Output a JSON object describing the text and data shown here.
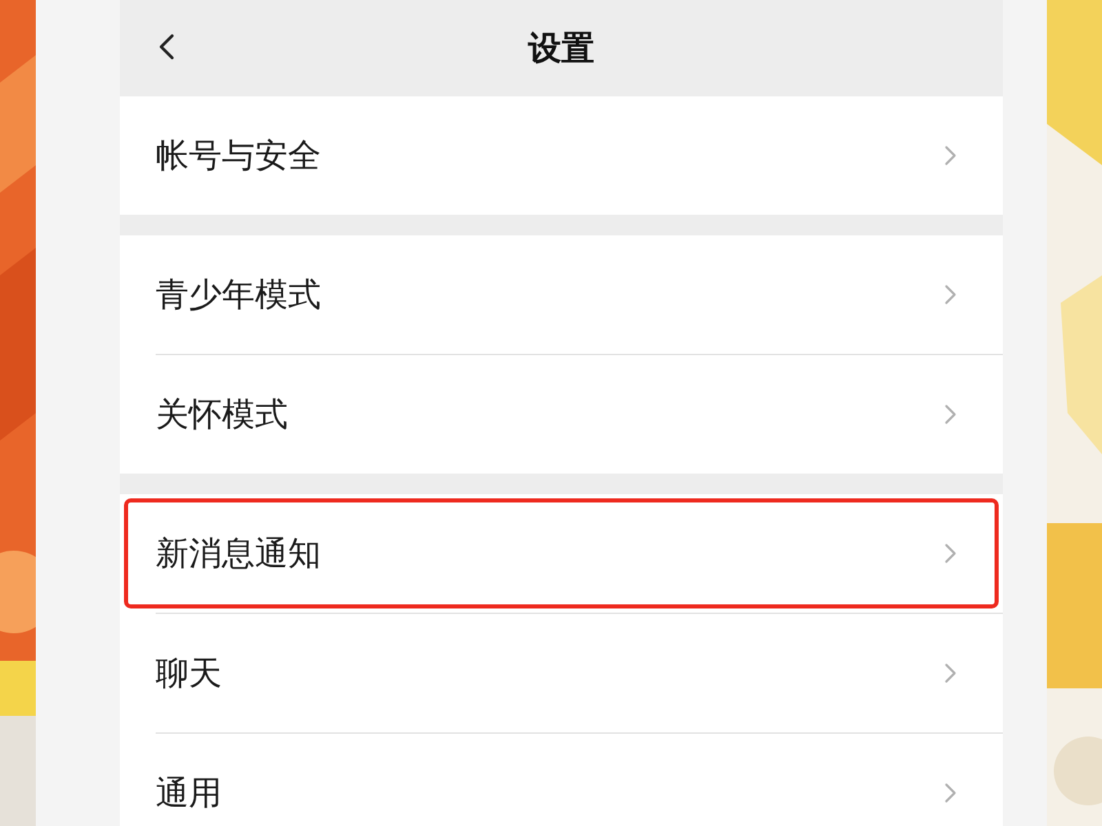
{
  "header": {
    "title": "设置"
  },
  "groups": [
    {
      "items": [
        {
          "label": "帐号与安全",
          "highlighted": false
        }
      ]
    },
    {
      "items": [
        {
          "label": "青少年模式",
          "highlighted": false
        },
        {
          "label": "关怀模式",
          "highlighted": false
        }
      ]
    },
    {
      "items": [
        {
          "label": "新消息通知",
          "highlighted": true
        },
        {
          "label": "聊天",
          "highlighted": false
        },
        {
          "label": "通用",
          "highlighted": false
        }
      ]
    }
  ]
}
